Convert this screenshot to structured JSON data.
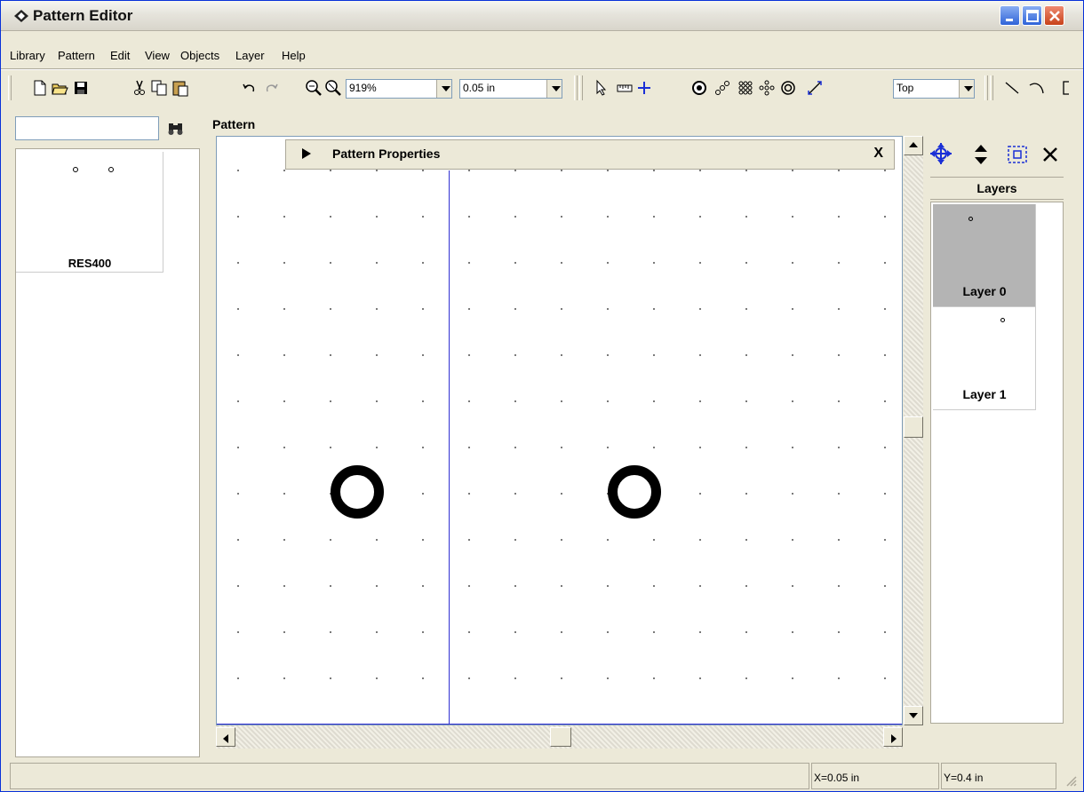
{
  "window": {
    "title": "Pattern Editor"
  },
  "menu": [
    "Library",
    "Pattern",
    "Edit",
    "View",
    "Objects",
    "Layer",
    "Help"
  ],
  "toolbar": {
    "zoom_value": "919%",
    "grid_value": "0.05 in",
    "side_value": "Top",
    "icons": [
      "new-icon",
      "open-icon",
      "save-icon",
      "cut-icon",
      "copy-icon",
      "paste-icon",
      "undo-icon",
      "redo-icon",
      "zoom-in-icon",
      "zoom-out-icon",
      "select-icon",
      "measure-icon",
      "origin-icon",
      "pad-icon",
      "pad-series-icon",
      "pad-array-icon",
      "pad-pattern-icon",
      "pad-circle-icon",
      "dimension-icon",
      "line-icon",
      "arc-icon",
      "rectangle-icon"
    ]
  },
  "library": {
    "search_value": "",
    "items": [
      {
        "label": "RES400"
      }
    ]
  },
  "pattern_group": {
    "label": "Pattern"
  },
  "pattern_properties": {
    "title": "Pattern Properties",
    "close_label": "X"
  },
  "layers": {
    "header": "Layers",
    "items": [
      {
        "label": "Layer 0",
        "selected": true
      },
      {
        "label": "Layer 1",
        "selected": false
      }
    ]
  },
  "status": {
    "x": "X=0.05 in",
    "y": "Y=0.4 in"
  },
  "colors": {
    "guide_line": "#3232d2",
    "selection": "#b4b4b4",
    "title_bar": "#e6e4dc"
  }
}
